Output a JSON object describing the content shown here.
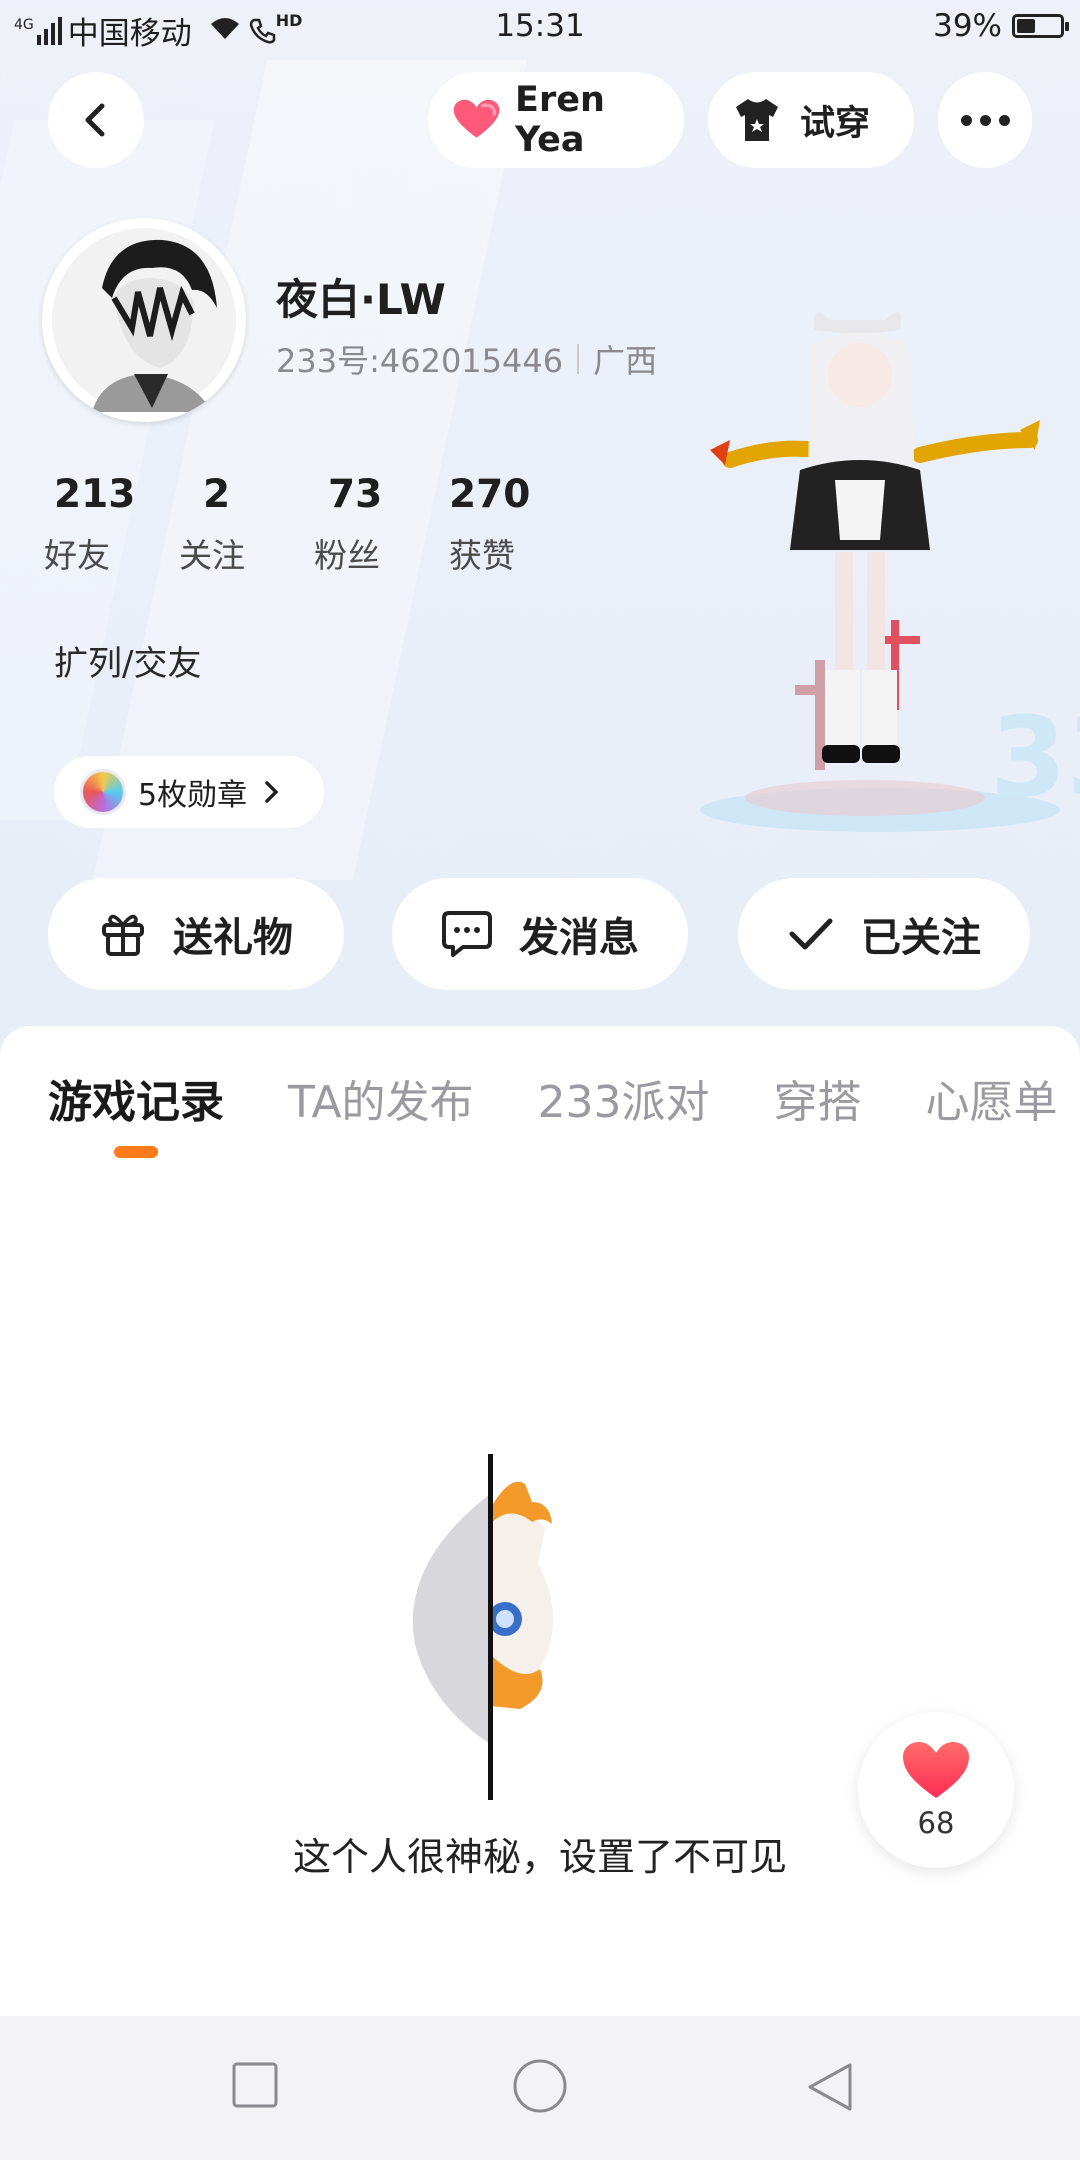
{
  "status_bar": {
    "signal": "4G",
    "carrier": "中国移动",
    "hd": "HD",
    "time": "15:31",
    "battery_percent": "39%",
    "battery_level": 0.39
  },
  "top_nav": {
    "pair_name": "Eren Yea",
    "try_on_label": "试穿"
  },
  "profile": {
    "username": "夜白·LW",
    "id_text": "233号:462015446",
    "region": "广西",
    "stats": [
      {
        "value": "213",
        "label": "好友"
      },
      {
        "value": "2",
        "label": "关注"
      },
      {
        "value": "73",
        "label": "粉丝"
      },
      {
        "value": "270",
        "label": "获赞"
      }
    ],
    "bio": "扩列/交友",
    "badges_label": "5枚勋章"
  },
  "actions": {
    "gift": "送礼物",
    "message": "发消息",
    "follow": "已关注"
  },
  "tabs": [
    {
      "label": "游戏记录",
      "active": true
    },
    {
      "label": "TA的发布",
      "active": false
    },
    {
      "label": "233派对",
      "active": false
    },
    {
      "label": "穿搭",
      "active": false
    },
    {
      "label": "心愿单",
      "active": false
    }
  ],
  "empty_state": {
    "text": "这个人很神秘，设置了不可见"
  },
  "floating_like": {
    "count": "68"
  },
  "colors": {
    "accent": "#ff7a1a",
    "heart": "#ff4d6d"
  }
}
